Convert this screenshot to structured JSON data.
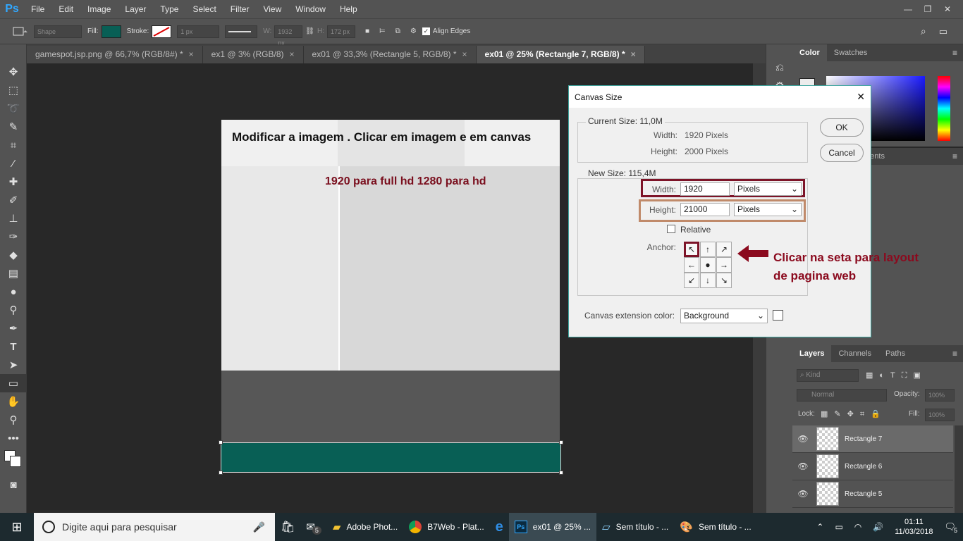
{
  "menubar": {
    "logo": "Ps",
    "items": [
      "File",
      "Edit",
      "Image",
      "Layer",
      "Type",
      "Select",
      "Filter",
      "View",
      "Window",
      "Help"
    ],
    "controls": [
      "—",
      "❐",
      "✕"
    ]
  },
  "options": {
    "shape_mode": "Shape",
    "fill_label": "Fill:",
    "fill_color": "#085f55",
    "stroke_label": "Stroke:",
    "stroke_width": "1 px",
    "w_label": "W:",
    "w_value": "1932 px",
    "h_label": "H:",
    "h_value": "172 px",
    "align_edges": "Align Edges"
  },
  "tabs": [
    {
      "label": "gamespot.jsp.png @ 66,7% (RGB/8#) *"
    },
    {
      "label": "ex1 @ 3% (RGB/8)"
    },
    {
      "label": "ex01 @ 33,3% (Rectangle 5, RGB/8) *"
    },
    {
      "label": "ex01 @ 25% (Rectangle 7, RGB/8) *"
    }
  ],
  "tab_close": "×",
  "document": {
    "title": "Modificar a imagem . Clicar em imagem e em canvas",
    "subtitle": "1920 para full hd 1280 para hd"
  },
  "dialog": {
    "title": "Canvas Size",
    "close": "✕",
    "current_size_legend": "Current Size: 11,0M",
    "width_label": "Width:",
    "current_width": "1920 Pixels",
    "height_label": "Height:",
    "current_height": "2000 Pixels",
    "new_size_legend": "New Size: 115,4M",
    "new_width": "1920",
    "new_height": "21000",
    "unit": "Pixels",
    "relative_label": "Relative",
    "anchor_label": "Anchor:",
    "anchor_grid": [
      "↖",
      "↑",
      "↗",
      "←",
      "●",
      "→",
      "↙",
      "↓",
      "↘"
    ],
    "ext_label": "Canvas extension color:",
    "ext_value": "Background",
    "ok": "OK",
    "cancel": "Cancel"
  },
  "annotation": {
    "line1": "Clicar na seta para layout",
    "line2": "de pagina web",
    "color": "#8b0a1e"
  },
  "color_panel": {
    "tabs": [
      "Color",
      "Swatches"
    ]
  },
  "adj_panel_partial": "ents",
  "layers_panel": {
    "tabs": [
      "Layers",
      "Channels",
      "Paths"
    ],
    "kind": "Kind",
    "blend": "Normal",
    "opacity_label": "Opacity:",
    "opacity": "100%",
    "lock_label": "Lock:",
    "fill_label": "Fill:",
    "fill": "100%",
    "layers": [
      {
        "name": "Rectangle 7",
        "selected": true
      },
      {
        "name": "Rectangle 6",
        "selected": false
      },
      {
        "name": "Rectangle 5",
        "selected": false
      }
    ]
  },
  "taskbar": {
    "search_placeholder": "Digite aqui para pesquisar",
    "mail_badge": "5",
    "apps": [
      {
        "label": "Adobe Phot..."
      },
      {
        "label": "B7Web - Plat..."
      },
      {
        "label": "ex01 @ 25% ..."
      },
      {
        "label": "Sem título - ..."
      },
      {
        "label": "Sem título - ..."
      }
    ],
    "time": "01:11",
    "date": "11/03/2018",
    "notif_count": "5"
  }
}
